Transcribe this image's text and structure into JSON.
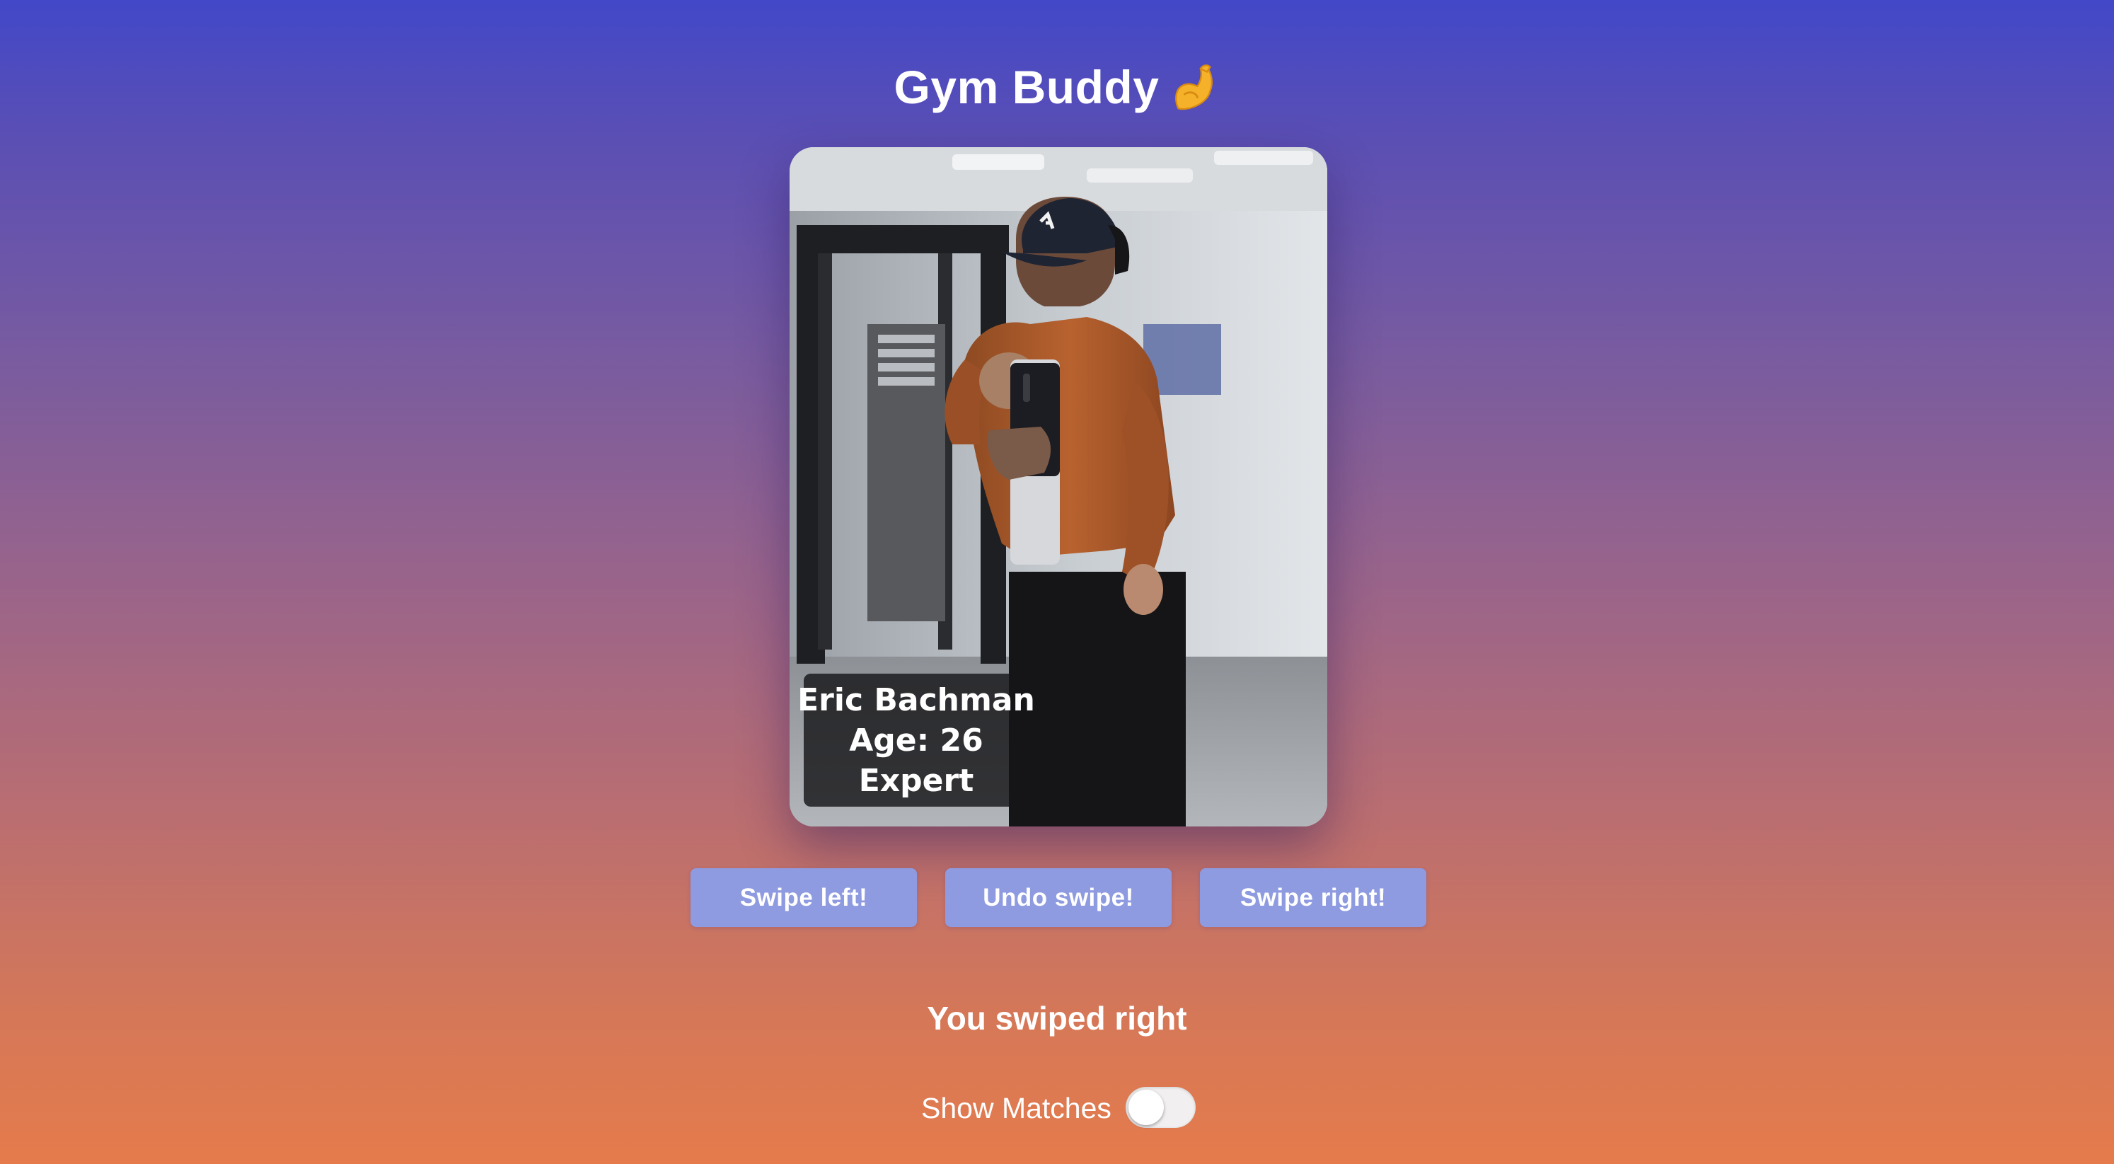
{
  "app": {
    "title": "Gym Buddy",
    "title_icon": "flexed-biceps-icon"
  },
  "profile": {
    "name": "Eric Bachman",
    "age": "Age: 26",
    "level": "Expert",
    "photo": "gym-mirror-selfie-photo"
  },
  "actions": {
    "swipe_left_label": "Swipe left!",
    "undo_label": "Undo swipe!",
    "swipe_right_label": "Swipe right!"
  },
  "status": {
    "message": "You swiped right"
  },
  "matches": {
    "label": "Show Matches",
    "toggle_on": false
  },
  "colors": {
    "gradient_top": "#4248c8",
    "gradient_bottom": "#e57b4c",
    "button_bg": "#8f9be0",
    "text": "#ffffff",
    "info_overlay": "#161618"
  }
}
